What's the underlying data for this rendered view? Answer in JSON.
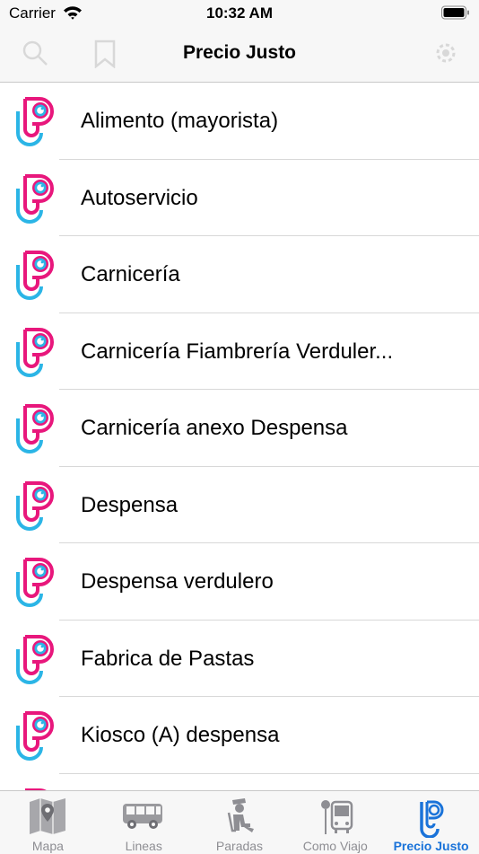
{
  "status": {
    "carrier": "Carrier",
    "time": "10:32 AM"
  },
  "nav": {
    "title": "Precio Justo"
  },
  "list": {
    "items": [
      {
        "label": "Alimento (mayorista)"
      },
      {
        "label": "Autoservicio"
      },
      {
        "label": "Carnicería"
      },
      {
        "label": "Carnicería Fiambrería Verduler..."
      },
      {
        "label": "Carnicería anexo Despensa"
      },
      {
        "label": "Despensa"
      },
      {
        "label": "Despensa verdulero"
      },
      {
        "label": "Fabrica de Pastas"
      },
      {
        "label": "Kiosco (A) despensa"
      }
    ]
  },
  "tabs": [
    {
      "label": "Mapa",
      "icon": "map-icon"
    },
    {
      "label": "Lineas",
      "icon": "bus-icon"
    },
    {
      "label": "Paradas",
      "icon": "passenger-icon"
    },
    {
      "label": "Como Viajo",
      "icon": "bus-stop-icon"
    },
    {
      "label": "Precio Justo",
      "icon": "precio-justo-icon",
      "active": true
    }
  ],
  "colors": {
    "brand_pink": "#e8177c",
    "brand_cyan": "#2bb5e6",
    "active_tab": "#1a73d9"
  }
}
